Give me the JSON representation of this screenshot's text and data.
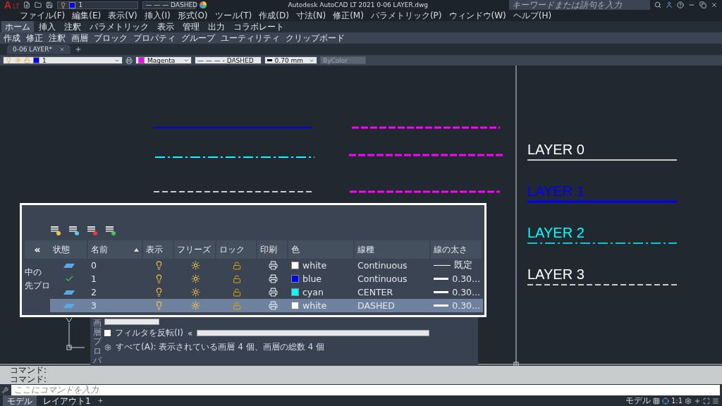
{
  "title_bar": {
    "logo": "A",
    "logo_sub": "LT",
    "layer": "1",
    "linetype": "— — —  DASHED",
    "title": "Autodesk AutoCAD LT 2021   0-06 LAYER.dwg",
    "search_placeholder": "キーワードまたは語句を入力"
  },
  "menu": [
    "ファイル(F)",
    "編集(E)",
    "表示(V)",
    "挿入(I)",
    "形式(O)",
    "ツール(T)",
    "作成(D)",
    "寸法(N)",
    "修正(M)",
    "パラメトリック(P)",
    "ウィンドウ(W)",
    "ヘルプ(H)"
  ],
  "ribbon_tabs": [
    {
      "label": "ホーム",
      "selected": true
    },
    {
      "label": "挿入",
      "selected": false
    },
    {
      "label": "注釈",
      "selected": false
    },
    {
      "label": "パラメトリック",
      "selected": false
    },
    {
      "label": "表示",
      "selected": false
    },
    {
      "label": "管理",
      "selected": false
    },
    {
      "label": "出力",
      "selected": false
    },
    {
      "label": "コラボレート",
      "selected": false
    }
  ],
  "ribbon_panels": [
    "作成",
    "修正",
    "注釈",
    "画層",
    "ブロック",
    "プロパティ",
    "グループ",
    "ユーティリティ",
    "クリップボード"
  ],
  "doc_tab": {
    "label": "0-06 LAYER*"
  },
  "properties": {
    "layer": "1",
    "color_label": "Magenta",
    "linetype": "— — — - DASHED",
    "lineweight": "0.70 mm",
    "plot_style": "ByColor",
    "plot_style_disabled": true
  },
  "canvas": {
    "labels": [
      {
        "text": "LAYER 0",
        "color": "#ffffff",
        "kind": "continuous"
      },
      {
        "text": "LAYER 1",
        "color": "#0000ff",
        "kind": "thick"
      },
      {
        "text": "LAYER 2",
        "color": "#00ffff",
        "kind": "center"
      },
      {
        "text": "LAYER 3",
        "color": "#ffffff",
        "kind": "dashed"
      }
    ]
  },
  "layer_panel": {
    "collapse": "«",
    "side_labels": [
      "中の",
      "先プロ"
    ],
    "columns": [
      {
        "label": "状態",
        "sorted": false
      },
      {
        "label": "名前",
        "sorted": true
      },
      {
        "label": "表示",
        "sorted": false
      },
      {
        "label": "フリーズ",
        "sorted": false
      },
      {
        "label": "ロック",
        "sorted": false
      },
      {
        "label": "印刷",
        "sorted": false
      },
      {
        "label": "色",
        "sorted": false
      },
      {
        "label": "線種",
        "sorted": false
      },
      {
        "label": "線の太さ",
        "sorted": false
      }
    ],
    "rows": [
      {
        "kind": "layer",
        "name": "0",
        "on": true,
        "frozen": false,
        "locked": false,
        "color_name": "white",
        "color": "#ffffff",
        "linetype": "Continuous",
        "lineweight": {
          "text": "既定",
          "kind": "thin"
        },
        "selected": false
      },
      {
        "kind": "current",
        "name": "1",
        "on": true,
        "frozen": false,
        "locked": false,
        "color_name": "blue",
        "color": "#0000ff",
        "linetype": "Continuous",
        "lineweight": {
          "text": "0.30...",
          "kind": "thick"
        },
        "selected": false
      },
      {
        "kind": "layer",
        "name": "2",
        "on": true,
        "frozen": false,
        "locked": false,
        "color_name": "cyan",
        "color": "#00ffff",
        "linetype": "CENTER",
        "lineweight": {
          "text": "0.30...",
          "kind": "thick"
        },
        "selected": false
      },
      {
        "kind": "layer",
        "name": "3",
        "on": true,
        "frozen": false,
        "locked": false,
        "color_name": "white",
        "color": "#ffffff",
        "linetype": "DASHED",
        "lineweight": {
          "text": "0.30...",
          "kind": "thick"
        },
        "selected": true
      }
    ],
    "side_title": "画層プロパ",
    "filter": {
      "label": "フィルタを反転(I)",
      "checked": false
    },
    "collapse_bottom": "«",
    "summary": "すべて(A): 表示されている画層 4 個、画層の総数 4 個"
  },
  "command": {
    "history": [
      "コマンド:",
      "コマンド:"
    ],
    "placeholder": "ここにコマンドを入力"
  },
  "layout_tabs": [
    {
      "label": "モデル",
      "selected": true
    },
    {
      "label": "レイアウト1",
      "selected": false
    }
  ],
  "status_bar": {
    "space": "モデル",
    "scale": "1:1"
  }
}
